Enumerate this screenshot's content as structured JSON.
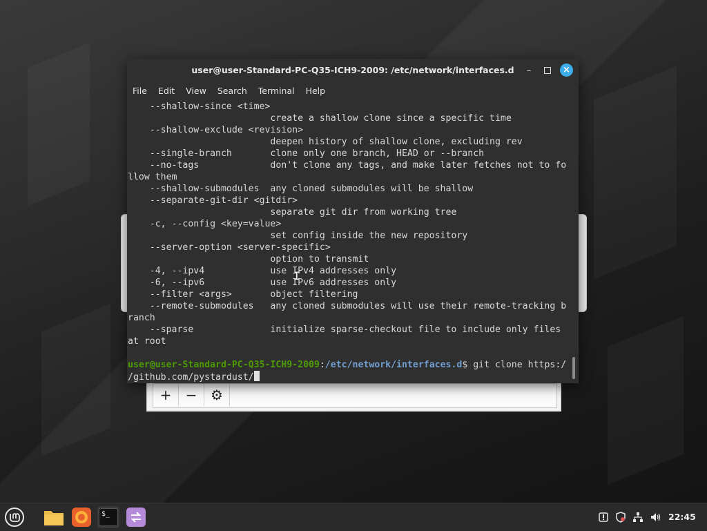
{
  "window": {
    "title": "user@user-Standard-PC-Q35-ICH9-2009: /etc/network/interfaces.d",
    "minimize_glyph": "–",
    "maximize_glyph": "□",
    "close_glyph": "×"
  },
  "menu": [
    "File",
    "Edit",
    "View",
    "Search",
    "Terminal",
    "Help"
  ],
  "terminal": {
    "lines": [
      "    --shallow-since <time>",
      "                          create a shallow clone since a specific time",
      "    --shallow-exclude <revision>",
      "                          deepen history of shallow clone, excluding rev",
      "    --single-branch       clone only one branch, HEAD or --branch",
      "    --no-tags             don't clone any tags, and make later fetches not to fo",
      "llow them",
      "    --shallow-submodules  any cloned submodules will be shallow",
      "    --separate-git-dir <gitdir>",
      "                          separate git dir from working tree",
      "    -c, --config <key=value>",
      "                          set config inside the new repository",
      "    --server-option <server-specific>",
      "                          option to transmit",
      "    -4, --ipv4            use IPv4 addresses only",
      "    -6, --ipv6            use IPv6 addresses only",
      "    --filter <args>       object filtering",
      "    --remote-submodules   any cloned submodules will use their remote-tracking b",
      "ranch",
      "    --sparse              initialize sparse-checkout file to include only files",
      "at root",
      ""
    ],
    "prompt_user": "user@user-Standard-PC-Q35-ICH9-2009",
    "prompt_sep": ":",
    "prompt_path": "/etc/network/interfaces.d",
    "prompt_symbol": "$ ",
    "command_line1": "git clone https:/",
    "command_line2": "/github.com/pystardust/"
  },
  "background_window": {
    "toolbar": [
      {
        "name": "add-button",
        "glyph": "+"
      },
      {
        "name": "remove-button",
        "glyph": "−"
      },
      {
        "name": "settings-button",
        "glyph": "⚙"
      }
    ]
  },
  "taskbar": {
    "apps": [
      {
        "name": "menu-icon",
        "label": "Linux Mint menu"
      },
      {
        "name": "files-icon",
        "label": "Files"
      },
      {
        "name": "firefox-icon",
        "label": "Firefox"
      },
      {
        "name": "terminal-icon",
        "label": "Terminal"
      },
      {
        "name": "app-icon",
        "label": "App"
      }
    ],
    "terminal_glyph": "$_",
    "clock": "22:45"
  },
  "colors": {
    "accent": "#3daee9",
    "prompt_user": "#4e9a06",
    "prompt_path": "#729fcf",
    "terminal_bg": "#2f2f2f"
  }
}
